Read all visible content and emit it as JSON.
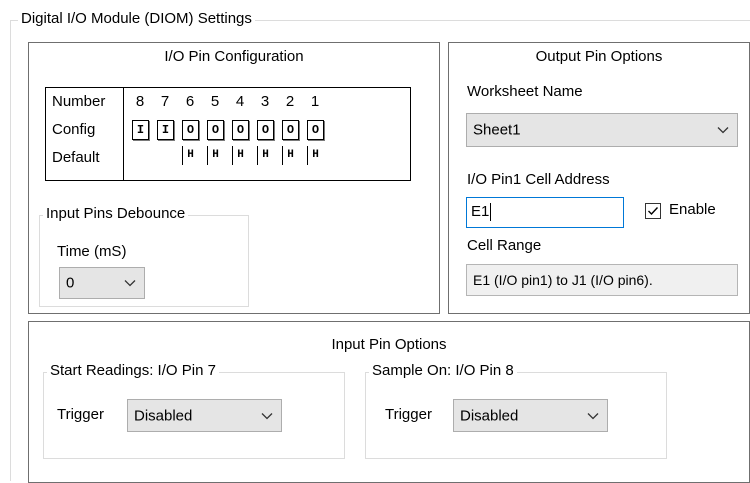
{
  "settings_group": {
    "title": "Digital I/O Module (DIOM) Settings"
  },
  "pin_config": {
    "title": "I/O Pin Configuration",
    "row_labels": {
      "number": "Number",
      "config": "Config",
      "default": "Default"
    },
    "pins": [
      {
        "number": "8",
        "config": "I",
        "default": ""
      },
      {
        "number": "7",
        "config": "I",
        "default": ""
      },
      {
        "number": "6",
        "config": "O",
        "default": "H"
      },
      {
        "number": "5",
        "config": "O",
        "default": "H"
      },
      {
        "number": "4",
        "config": "O",
        "default": "H"
      },
      {
        "number": "3",
        "config": "O",
        "default": "H"
      },
      {
        "number": "2",
        "config": "O",
        "default": "H"
      },
      {
        "number": "1",
        "config": "O",
        "default": "H"
      }
    ]
  },
  "debounce": {
    "title": "Input Pins Debounce",
    "time_label": "Time (mS)",
    "time_value": "0"
  },
  "output_options": {
    "title": "Output Pin Options",
    "worksheet_label": "Worksheet Name",
    "worksheet_value": "Sheet1",
    "cell_address_label": "I/O Pin1 Cell Address",
    "cell_address_value": "E1",
    "enable_label": "Enable",
    "enable_checked": true,
    "cell_range_label": "Cell Range",
    "cell_range_value": "E1 (I/O pin1) to J1 (I/O pin6)."
  },
  "input_options": {
    "title": "Input Pin Options",
    "start_readings": {
      "title": "Start Readings: I/O Pin 7",
      "trigger_label": "Trigger",
      "trigger_value": "Disabled"
    },
    "sample_on": {
      "title": "Sample On: I/O Pin 8",
      "trigger_label": "Trigger",
      "trigger_value": "Disabled"
    }
  },
  "icons": {
    "chevron": "chevron-down-icon",
    "check": "checkmark-icon"
  }
}
